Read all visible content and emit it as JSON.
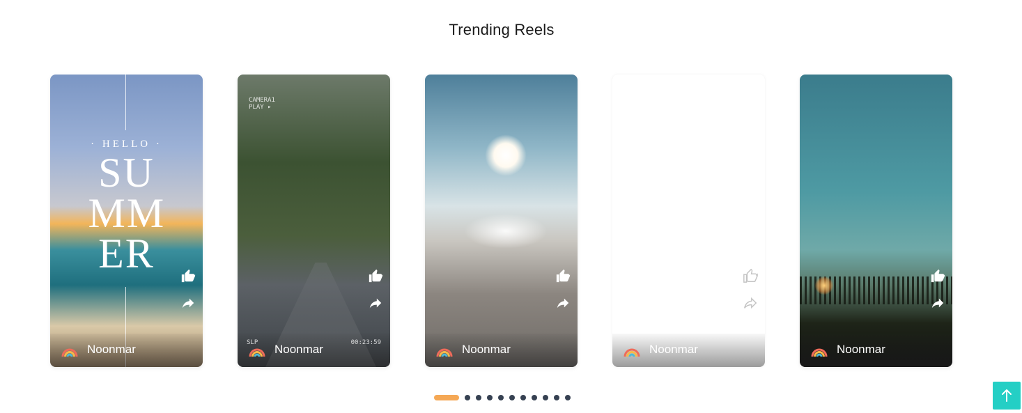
{
  "section": {
    "title": "Trending Reels"
  },
  "reels": [
    {
      "channel": "Noonmar",
      "overlay": {
        "hello": "· HELLO ·",
        "summer": "SU MM ER"
      },
      "icons": {
        "like": "thumbs-up-icon",
        "share": "share-icon"
      }
    },
    {
      "channel": "Noonmar",
      "overlay": {
        "camera": "CAMERA1",
        "play": "PLAY ▸",
        "slp": "SLP",
        "timecode": "00:23:59"
      },
      "icons": {
        "like": "thumbs-up-icon",
        "share": "share-icon"
      }
    },
    {
      "channel": "Noonmar",
      "icons": {
        "like": "thumbs-up-icon",
        "share": "share-icon"
      }
    },
    {
      "channel": "Noonmar",
      "icons": {
        "like": "thumbs-up-icon",
        "share": "share-icon"
      }
    },
    {
      "channel": "Noonmar",
      "icons": {
        "like": "thumbs-up-icon",
        "share": "share-icon"
      }
    }
  ],
  "pagination": {
    "total_pages": 11,
    "active_page": 1,
    "active_color": "#f5a855",
    "dot_color": "#364152"
  },
  "scroll_top": {
    "icon": "arrow-up-icon",
    "color": "#24cfc5"
  }
}
